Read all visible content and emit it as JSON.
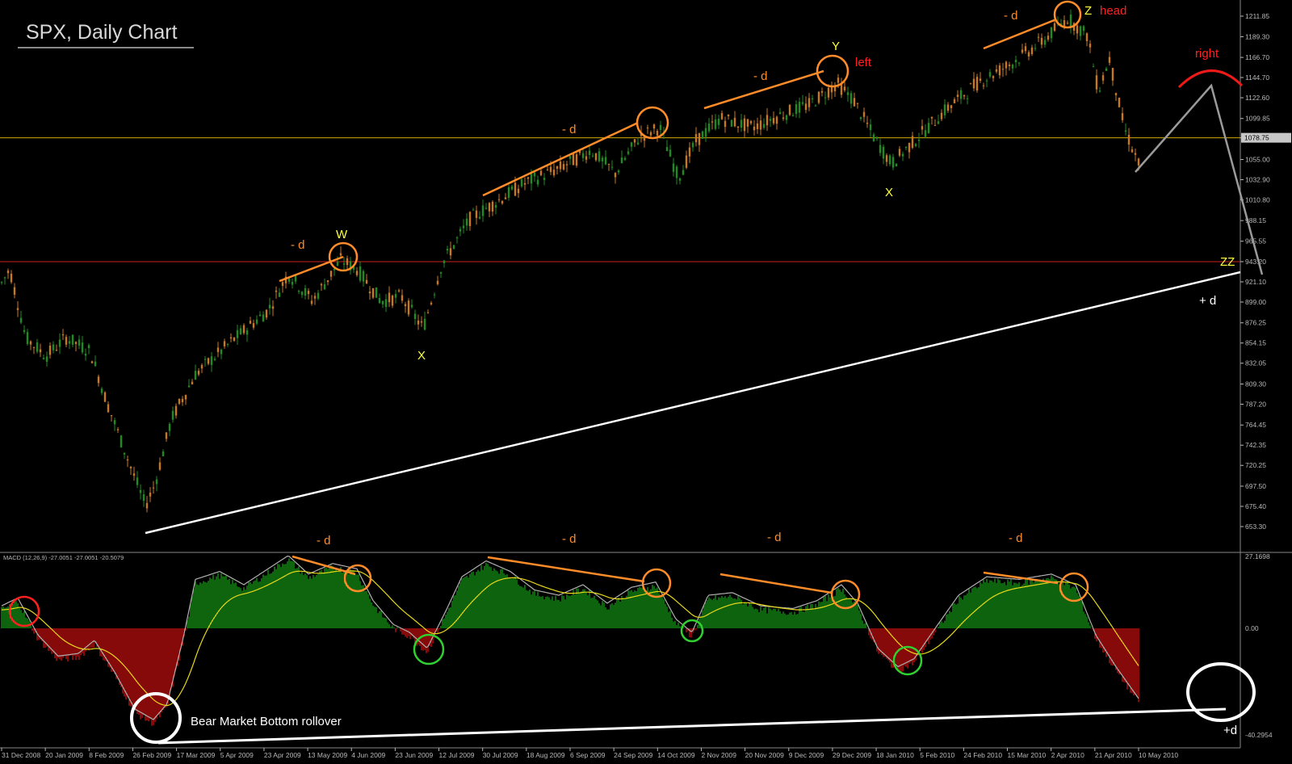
{
  "chart_title": "SPX, Daily Chart",
  "colors": {
    "background": "#000000",
    "bull_candle": "#1e8c1e",
    "bear_candle": "#c8781e",
    "orange": "#ff8c28",
    "yellow": "#ffff40",
    "red": "#ff2020",
    "white": "#ffffff",
    "green_circle": "#30d030",
    "hist_pos": "#18a818",
    "hist_neg": "#e01010",
    "signal": "#e8d818",
    "macd_line": "#b0b0b0",
    "axis": "#b8b8b8"
  },
  "chart_data": [
    {
      "type": "candlestick",
      "price_axis_ticks": [
        "1211.85",
        "1189.30",
        "1166.70",
        "1144.70",
        "1122.60",
        "1099.85",
        "1078.75",
        "1055.00",
        "1032.90",
        "1010.80",
        "988.15",
        "965.55",
        "943.20",
        "921.10",
        "899.00",
        "876.25",
        "854.15",
        "832.05",
        "809.30",
        "787.20",
        "764.45",
        "742.35",
        "720.25",
        "697.50",
        "675.40",
        "653.30"
      ],
      "price_range": [
        653.3,
        1211.85
      ],
      "horizontal_levels": [
        {
          "value": 1078.75,
          "color": "#d4a800",
          "label": "1078.75"
        },
        {
          "value": 943.2,
          "color": "#cc2020"
        }
      ],
      "date_labels": [
        "31 Dec 2008",
        "20 Jan 2009",
        "8 Feb 2009",
        "26 Feb 2009",
        "17 Mar 2009",
        "5 Apr 2009",
        "23 Apr 2009",
        "13 May 2009",
        "4 Jun 2009",
        "23 Jun 2009",
        "12 Jul 2009",
        "30 Jul 2009",
        "18 Aug 2009",
        "6 Sep 2009",
        "24 Sep 2009",
        "14 Oct 2009",
        "2 Nov 2009",
        "20 Nov 2009",
        "9 Dec 2009",
        "29 Dec 2009",
        "18 Jan 2010",
        "5 Feb 2010",
        "24 Feb 2010",
        "15 Mar 2010",
        "2 Apr 2010",
        "21 Apr 2010",
        "10 May 2010"
      ],
      "price_path": [
        {
          "t": 0,
          "v": 920
        },
        {
          "t": 10,
          "v": 935
        },
        {
          "t": 30,
          "v": 860
        },
        {
          "t": 55,
          "v": 840
        },
        {
          "t": 80,
          "v": 860
        },
        {
          "t": 110,
          "v": 845
        },
        {
          "t": 130,
          "v": 790
        },
        {
          "t": 155,
          "v": 730
        },
        {
          "t": 178,
          "v": 676
        },
        {
          "t": 190,
          "v": 700
        },
        {
          "t": 210,
          "v": 770
        },
        {
          "t": 240,
          "v": 820
        },
        {
          "t": 290,
          "v": 860
        },
        {
          "t": 330,
          "v": 890
        },
        {
          "t": 355,
          "v": 930
        },
        {
          "t": 385,
          "v": 900
        },
        {
          "t": 420,
          "v": 945
        },
        {
          "t": 440,
          "v": 935
        },
        {
          "t": 470,
          "v": 900
        },
        {
          "t": 495,
          "v": 905
        },
        {
          "t": 522,
          "v": 870
        },
        {
          "t": 545,
          "v": 940
        },
        {
          "t": 580,
          "v": 990
        },
        {
          "t": 615,
          "v": 1010
        },
        {
          "t": 650,
          "v": 1030
        },
        {
          "t": 690,
          "v": 1045
        },
        {
          "t": 730,
          "v": 1065
        },
        {
          "t": 760,
          "v": 1040
        },
        {
          "t": 790,
          "v": 1080
        },
        {
          "t": 815,
          "v": 1090
        },
        {
          "t": 838,
          "v": 1035
        },
        {
          "t": 860,
          "v": 1075
        },
        {
          "t": 890,
          "v": 1100
        },
        {
          "t": 930,
          "v": 1090
        },
        {
          "t": 960,
          "v": 1102
        },
        {
          "t": 1000,
          "v": 1115
        },
        {
          "t": 1035,
          "v": 1138
        },
        {
          "t": 1055,
          "v": 1120
        },
        {
          "t": 1080,
          "v": 1080
        },
        {
          "t": 1102,
          "v": 1050
        },
        {
          "t": 1130,
          "v": 1075
        },
        {
          "t": 1170,
          "v": 1110
        },
        {
          "t": 1210,
          "v": 1140
        },
        {
          "t": 1250,
          "v": 1160
        },
        {
          "t": 1290,
          "v": 1185
        },
        {
          "t": 1320,
          "v": 1210
        },
        {
          "t": 1345,
          "v": 1190
        },
        {
          "t": 1358,
          "v": 1130
        },
        {
          "t": 1372,
          "v": 1165
        },
        {
          "t": 1390,
          "v": 1090
        },
        {
          "t": 1408,
          "v": 1050
        }
      ]
    },
    {
      "type": "macd",
      "title": "MACD (12,26,9) -27.0051 -27.0051 -20.5079",
      "axis_labels": [
        "27.1698",
        "0.00",
        "-40.2954"
      ],
      "range": [
        -40.2954,
        27.1698
      ],
      "values": [
        {
          "t": 0,
          "v": 7
        },
        {
          "t": 20,
          "v": 10
        },
        {
          "t": 45,
          "v": -4
        },
        {
          "t": 70,
          "v": -12
        },
        {
          "t": 95,
          "v": -11
        },
        {
          "t": 115,
          "v": -6
        },
        {
          "t": 140,
          "v": -18
        },
        {
          "t": 165,
          "v": -32
        },
        {
          "t": 188,
          "v": -36
        },
        {
          "t": 205,
          "v": -30
        },
        {
          "t": 225,
          "v": -5
        },
        {
          "t": 240,
          "v": 17
        },
        {
          "t": 270,
          "v": 20
        },
        {
          "t": 300,
          "v": 15
        },
        {
          "t": 330,
          "v": 21
        },
        {
          "t": 355,
          "v": 26
        },
        {
          "t": 380,
          "v": 19
        },
        {
          "t": 410,
          "v": 23
        },
        {
          "t": 440,
          "v": 21
        },
        {
          "t": 460,
          "v": 9
        },
        {
          "t": 485,
          "v": 0
        },
        {
          "t": 505,
          "v": -3
        },
        {
          "t": 527,
          "v": -9
        },
        {
          "t": 550,
          "v": 5
        },
        {
          "t": 570,
          "v": 18
        },
        {
          "t": 600,
          "v": 24
        },
        {
          "t": 630,
          "v": 20
        },
        {
          "t": 660,
          "v": 13
        },
        {
          "t": 690,
          "v": 11
        },
        {
          "t": 720,
          "v": 15
        },
        {
          "t": 750,
          "v": 8
        },
        {
          "t": 780,
          "v": 14
        },
        {
          "t": 810,
          "v": 16
        },
        {
          "t": 835,
          "v": 2
        },
        {
          "t": 855,
          "v": -3
        },
        {
          "t": 875,
          "v": 11
        },
        {
          "t": 905,
          "v": 12
        },
        {
          "t": 940,
          "v": 7
        },
        {
          "t": 980,
          "v": 6
        },
        {
          "t": 1010,
          "v": 9
        },
        {
          "t": 1040,
          "v": 15
        },
        {
          "t": 1060,
          "v": 8
        },
        {
          "t": 1085,
          "v": -9
        },
        {
          "t": 1110,
          "v": -16
        },
        {
          "t": 1130,
          "v": -13
        },
        {
          "t": 1155,
          "v": -2
        },
        {
          "t": 1185,
          "v": 11
        },
        {
          "t": 1220,
          "v": 18
        },
        {
          "t": 1260,
          "v": 17
        },
        {
          "t": 1300,
          "v": 19
        },
        {
          "t": 1330,
          "v": 15
        },
        {
          "t": 1355,
          "v": -4
        },
        {
          "t": 1380,
          "v": -16
        },
        {
          "t": 1408,
          "v": -28
        }
      ]
    }
  ],
  "annotations": {
    "neg_d": "- d",
    "pos_d": "+ d",
    "pos_d_compact": "+d",
    "W": "W",
    "X": "X",
    "Y": "Y",
    "Z": "Z",
    "ZZ": "ZZ",
    "left": "left",
    "head": "head",
    "right": "right",
    "bear_bottom": "Bear Market Bottom rollover"
  }
}
